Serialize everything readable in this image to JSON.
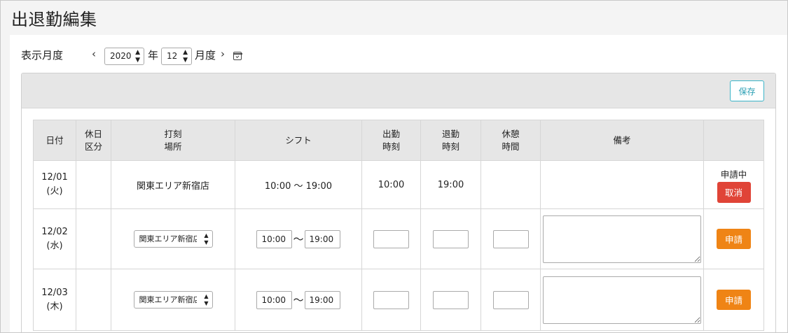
{
  "page": {
    "title": "出退勤編集"
  },
  "month_selector": {
    "label": "表示月度",
    "prev_icon": "‹",
    "next_icon": "›",
    "year_value": "2020",
    "year_unit": "年",
    "month_value": "12",
    "month_unit": "月度"
  },
  "toolbar": {
    "save_label": "保存"
  },
  "table": {
    "headers": {
      "date": "日付",
      "holiday_1": "休日",
      "holiday_2": "区分",
      "place_1": "打刻",
      "place_2": "場所",
      "shift": "シフト",
      "in_1": "出勤",
      "in_2": "時刻",
      "out_1": "退勤",
      "out_2": "時刻",
      "break_1": "休憩",
      "break_2": "時間",
      "note": "備考"
    },
    "rows": [
      {
        "date": "12/01",
        "weekday": "(火)",
        "place": "関東エリア新宿店",
        "shift": "10:00 〜 19:00",
        "in_time": "10:00",
        "out_time": "19:00",
        "status": "申請中",
        "action_label": "取消"
      },
      {
        "date": "12/02",
        "weekday": "(水)",
        "place": "関東エリア新宿店",
        "shift_start": "10:00",
        "shift_sep": "〜",
        "shift_end": "19:00",
        "action_label": "申請"
      },
      {
        "date": "12/03",
        "weekday": "(木)",
        "place": "関東エリア新宿店",
        "shift_start": "10:00",
        "shift_sep": "〜",
        "shift_end": "19:00",
        "action_label": "申請"
      }
    ]
  },
  "colors": {
    "cancel": "#e04437",
    "apply": "#ef8415",
    "save_border": "#3bb4c8",
    "header_bg": "#e6e6e6"
  }
}
